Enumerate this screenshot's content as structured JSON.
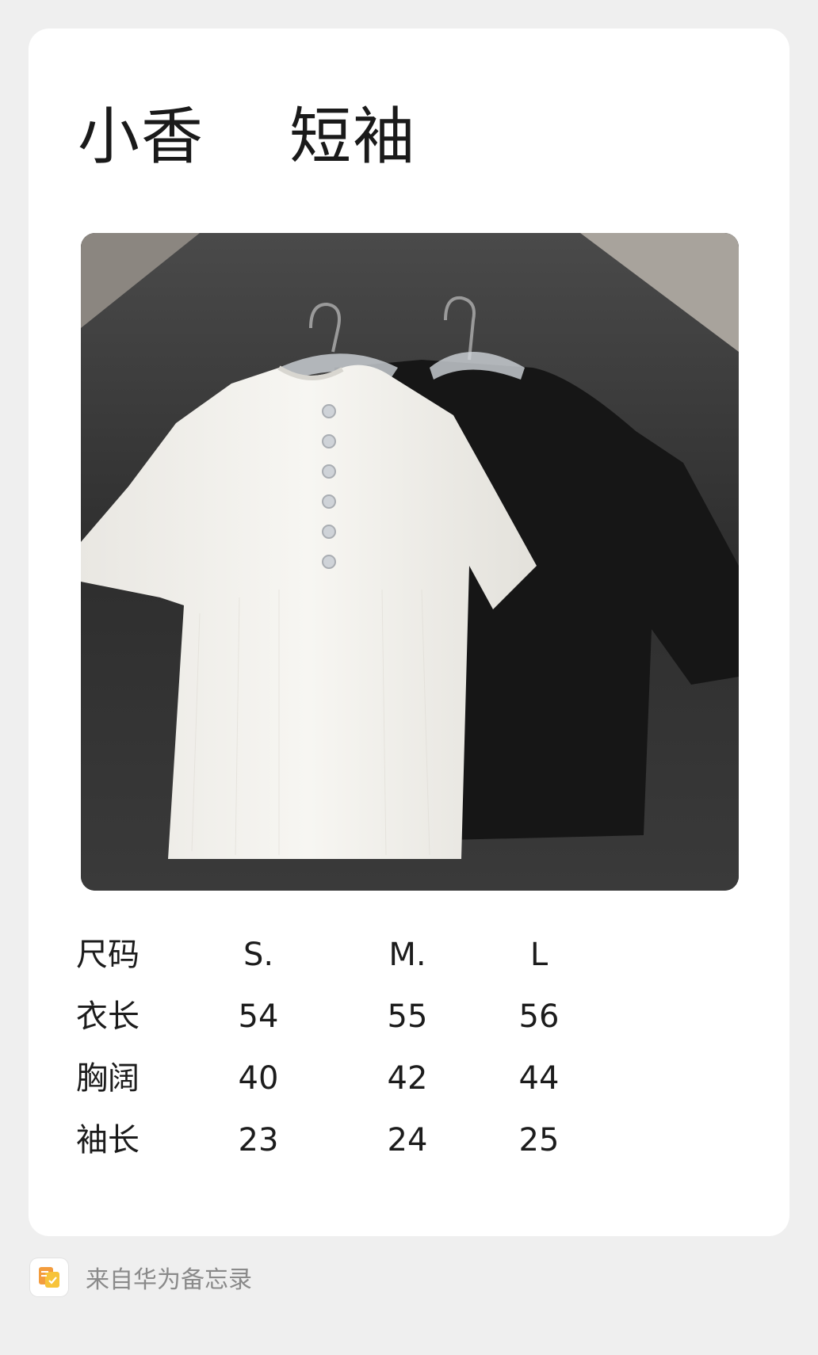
{
  "title": "小香    短袖",
  "photo": {
    "icon": "product-photo-two-knit-tees"
  },
  "size_table": {
    "header": [
      "尺码",
      "S.",
      "M.",
      "L"
    ],
    "rows": [
      [
        "衣长",
        "54",
        "55",
        "56"
      ],
      [
        "胸阔",
        "40",
        "42",
        "44"
      ],
      [
        "袖长",
        "23",
        "24",
        "25"
      ]
    ]
  },
  "footer": {
    "text": "来自华为备忘录",
    "icon": "huawei-notes-icon",
    "icon_color": "#f5a623"
  }
}
